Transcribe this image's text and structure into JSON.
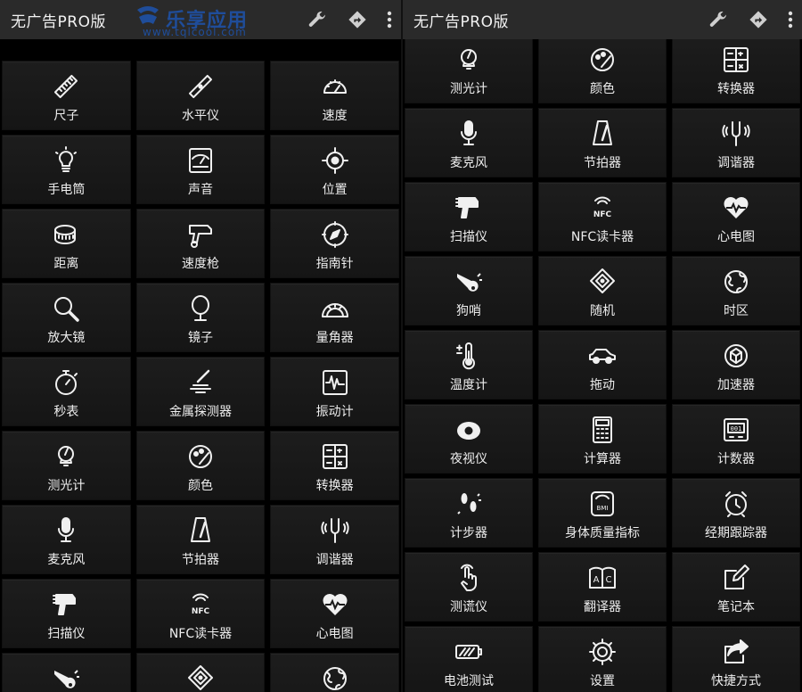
{
  "left": {
    "title": "无广告PRO版",
    "watermark": {
      "title": "乐享应用",
      "url": "www.tqlcool.com"
    },
    "tiles": [
      {
        "label": "尺子",
        "icon": "ruler-icon"
      },
      {
        "label": "水平仪",
        "icon": "level-icon"
      },
      {
        "label": "速度",
        "icon": "speedometer-icon"
      },
      {
        "label": "手电筒",
        "icon": "lightbulb-icon"
      },
      {
        "label": "声音",
        "icon": "sound-meter-icon"
      },
      {
        "label": "位置",
        "icon": "location-icon"
      },
      {
        "label": "距离",
        "icon": "tape-measure-icon"
      },
      {
        "label": "速度枪",
        "icon": "speed-gun-icon"
      },
      {
        "label": "指南针",
        "icon": "compass-icon"
      },
      {
        "label": "放大镜",
        "icon": "magnifier-icon"
      },
      {
        "label": "镜子",
        "icon": "mirror-icon"
      },
      {
        "label": "量角器",
        "icon": "protractor-icon"
      },
      {
        "label": "秒表",
        "icon": "stopwatch-icon"
      },
      {
        "label": "金属探测器",
        "icon": "metal-detector-icon"
      },
      {
        "label": "振动计",
        "icon": "vibration-icon"
      },
      {
        "label": "测光计",
        "icon": "light-meter-icon"
      },
      {
        "label": "颜色",
        "icon": "color-picker-icon"
      },
      {
        "label": "转换器",
        "icon": "converter-icon"
      },
      {
        "label": "麦克风",
        "icon": "microphone-icon"
      },
      {
        "label": "节拍器",
        "icon": "metronome-icon"
      },
      {
        "label": "调谐器",
        "icon": "tuning-fork-icon"
      },
      {
        "label": "扫描仪",
        "icon": "scanner-icon"
      },
      {
        "label": "NFC读卡器",
        "icon": "nfc-icon"
      },
      {
        "label": "心电图",
        "icon": "heart-rate-icon"
      },
      {
        "label": "",
        "icon": "dog-whistle-icon"
      },
      {
        "label": "",
        "icon": "dice-icon"
      },
      {
        "label": "",
        "icon": "globe-icon"
      }
    ]
  },
  "right": {
    "title": "无广告PRO版",
    "tiles": [
      {
        "label": "测光计",
        "icon": "light-meter-icon"
      },
      {
        "label": "颜色",
        "icon": "color-picker-icon"
      },
      {
        "label": "转换器",
        "icon": "converter-icon"
      },
      {
        "label": "麦克风",
        "icon": "microphone-icon"
      },
      {
        "label": "节拍器",
        "icon": "metronome-icon"
      },
      {
        "label": "调谐器",
        "icon": "tuning-fork-icon"
      },
      {
        "label": "扫描仪",
        "icon": "scanner-icon"
      },
      {
        "label": "NFC读卡器",
        "icon": "nfc-icon"
      },
      {
        "label": "心电图",
        "icon": "heart-rate-icon"
      },
      {
        "label": "狗哨",
        "icon": "dog-whistle-icon"
      },
      {
        "label": "随机",
        "icon": "dice-icon"
      },
      {
        "label": "时区",
        "icon": "globe-icon"
      },
      {
        "label": "温度计",
        "icon": "thermometer-icon"
      },
      {
        "label": "拖动",
        "icon": "car-icon"
      },
      {
        "label": "加速器",
        "icon": "accelerometer-icon"
      },
      {
        "label": "夜视仪",
        "icon": "night-vision-icon"
      },
      {
        "label": "计算器",
        "icon": "calculator-icon"
      },
      {
        "label": "计数器",
        "icon": "counter-icon"
      },
      {
        "label": "计步器",
        "icon": "footsteps-icon"
      },
      {
        "label": "身体质量指标",
        "icon": "bmi-scale-icon"
      },
      {
        "label": "经期跟踪器",
        "icon": "alarm-clock-icon"
      },
      {
        "label": "测谎仪",
        "icon": "finger-touch-icon"
      },
      {
        "label": "翻译器",
        "icon": "translator-icon"
      },
      {
        "label": "笔记本",
        "icon": "notepad-icon"
      },
      {
        "label": "电池测试",
        "icon": "battery-icon"
      },
      {
        "label": "设置",
        "icon": "gear-icon"
      },
      {
        "label": "快捷方式",
        "icon": "share-icon"
      }
    ]
  },
  "colors": {
    "appbar": "#2a2a2a",
    "tile": "#1a1a1a",
    "watermark": "#1f4d9a"
  }
}
